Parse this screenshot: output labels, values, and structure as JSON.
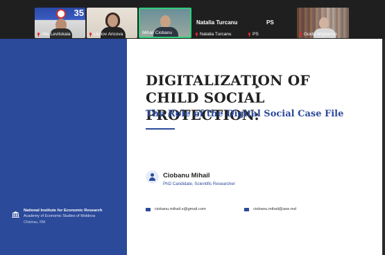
{
  "participants": [
    {
      "name": "Alla Levitskaia",
      "muted": true,
      "overlay_text": "35"
    },
    {
      "name": "Liubov Aricova",
      "muted": true
    },
    {
      "name": "Mihail Ciobanu",
      "muted": false,
      "active_speaker": true
    },
    {
      "name": "Natalia Turcanu",
      "muted": true,
      "display_name": "Natalia Turcanu"
    },
    {
      "name": "PS",
      "muted": true,
      "display_name": "PS"
    },
    {
      "name": "Guido Migliaccio",
      "muted": true
    }
  ],
  "slide": {
    "title": "DIGITALIZATION OF CHILD SOCIAL PROTECTION:",
    "subtitle": "The Role of the Digital Social Case File",
    "author": {
      "name": "Ciobanu Mihail",
      "role": "PhD Candidate, Scientific Researcher"
    },
    "emails": [
      "ciobanu.mihail.s@gmail.com",
      "ciobanu.mihail@ase.md"
    ],
    "institution": {
      "name": "National Institute for Economic Research",
      "subname": "Academy of Economic Studies of Moldova",
      "city": "Chisinau, RM"
    }
  },
  "colors": {
    "slide_blue": "#2c4a9a",
    "active_border": "#2fd07a",
    "muted_mic": "#e02a2a"
  },
  "icons": [
    "mic-muted-icon",
    "user-icon",
    "mail-icon",
    "institution-icon",
    "mouse-cursor-icon"
  ]
}
